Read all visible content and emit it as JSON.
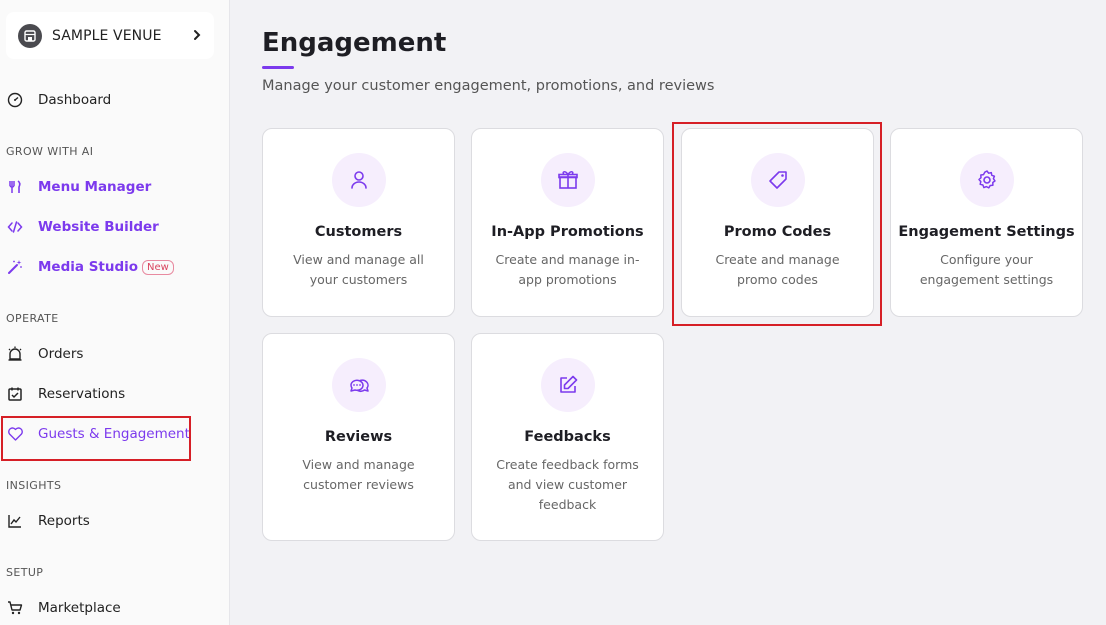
{
  "venue": {
    "name": "SAMPLE VENUE"
  },
  "sidebar": {
    "dashboard": "Dashboard",
    "sections": {
      "grow": "GROW WITH AI",
      "operate": "OPERATE",
      "insights": "INSIGHTS",
      "setup": "SETUP"
    },
    "menu_manager": "Menu Manager",
    "website_builder": "Website Builder",
    "media_studio": "Media Studio",
    "new_badge": "New",
    "orders": "Orders",
    "reservations": "Reservations",
    "guests_engagement": "Guests & Engagement",
    "reports": "Reports",
    "marketplace": "Marketplace"
  },
  "main": {
    "title": "Engagement",
    "subtitle": "Manage your customer engagement, promotions, and reviews"
  },
  "cards": [
    {
      "title": "Customers",
      "desc": "View and manage all your customers",
      "icon": "user-icon"
    },
    {
      "title": "In-App Promotions",
      "desc": "Create and manage in-app promotions",
      "icon": "gift-icon"
    },
    {
      "title": "Promo Codes",
      "desc": "Create and manage promo codes",
      "icon": "tag-icon"
    },
    {
      "title": "Engagement Settings",
      "desc": "Configure your engagement settings",
      "icon": "gear-icon"
    },
    {
      "title": "Reviews",
      "desc": "View and manage customer reviews",
      "icon": "chat-bubbles-icon"
    },
    {
      "title": "Feedbacks",
      "desc": "Create feedback forms and view customer feedback",
      "icon": "edit-icon"
    }
  ],
  "colors": {
    "accent": "#7c3aed",
    "highlight": "#d61f26"
  }
}
